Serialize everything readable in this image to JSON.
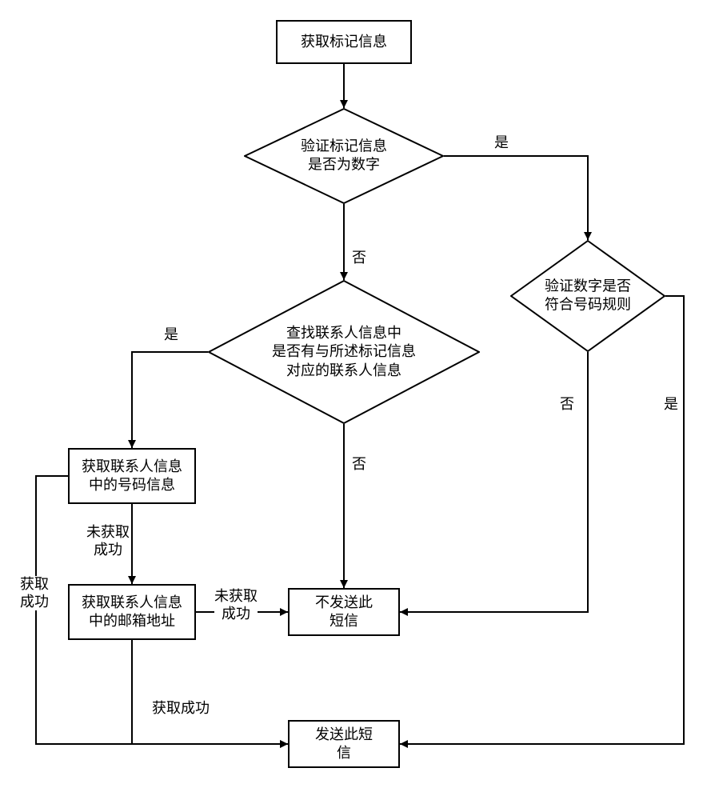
{
  "chart_data": {
    "type": "flowchart",
    "nodes": [
      {
        "id": "start",
        "shape": "rect",
        "text": "获取标记信息"
      },
      {
        "id": "d1",
        "shape": "diamond",
        "text": "验证标记信息\n是否为数字"
      },
      {
        "id": "d2",
        "shape": "diamond",
        "text": "查找联系人信息中\n是否有与所述标记信息\n对应的联系人信息"
      },
      {
        "id": "d3",
        "shape": "diamond",
        "text": "验证数字是否\n符合号码规则"
      },
      {
        "id": "r1",
        "shape": "rect",
        "text": "获取联系人信息\n中的号码信息"
      },
      {
        "id": "r2",
        "shape": "rect",
        "text": "获取联系人信息\n中的邮箱地址"
      },
      {
        "id": "r3",
        "shape": "rect",
        "text": "不发送此\n短信"
      },
      {
        "id": "r4",
        "shape": "rect",
        "text": "发送此短\n信"
      }
    ],
    "edges": [
      {
        "from": "start",
        "to": "d1"
      },
      {
        "from": "d1",
        "to": "d3",
        "label": "是"
      },
      {
        "from": "d1",
        "to": "d2",
        "label": "否"
      },
      {
        "from": "d2",
        "to": "r1",
        "label": "是"
      },
      {
        "from": "d2",
        "to": "r3",
        "label": "否"
      },
      {
        "from": "d3",
        "to": "r3",
        "label": "否"
      },
      {
        "from": "d3",
        "to": "r4",
        "label": "是"
      },
      {
        "from": "r1",
        "to": "r2",
        "label": "未获取\n成功"
      },
      {
        "from": "r1",
        "to": "r4",
        "label": "获取\n成功"
      },
      {
        "from": "r2",
        "to": "r3",
        "label": "未获取\n成功"
      },
      {
        "from": "r2",
        "to": "r4",
        "label": "获取成功"
      }
    ]
  },
  "nodes": {
    "start": "获取标记信息",
    "d1_l1": "验证标记信息",
    "d1_l2": "是否为数字",
    "d2_l1": "查找联系人信息中",
    "d2_l2": "是否有与所述标记信息",
    "d2_l3": "对应的联系人信息",
    "d3_l1": "验证数字是否",
    "d3_l2": "符合号码规则",
    "r1_l1": "获取联系人信息",
    "r1_l2": "中的号码信息",
    "r2_l1": "获取联系人信息",
    "r2_l2": "中的邮箱地址",
    "r3_l1": "不发送此",
    "r3_l2": "短信",
    "r4_l1": "发送此短",
    "r4_l2": "信"
  },
  "labels": {
    "yes": "是",
    "no": "否",
    "get_ok": "获取成功",
    "get_ok_v1": "获取",
    "get_ok_v2": "成功",
    "get_fail_l1": "未获取",
    "get_fail_l2": "成功"
  }
}
